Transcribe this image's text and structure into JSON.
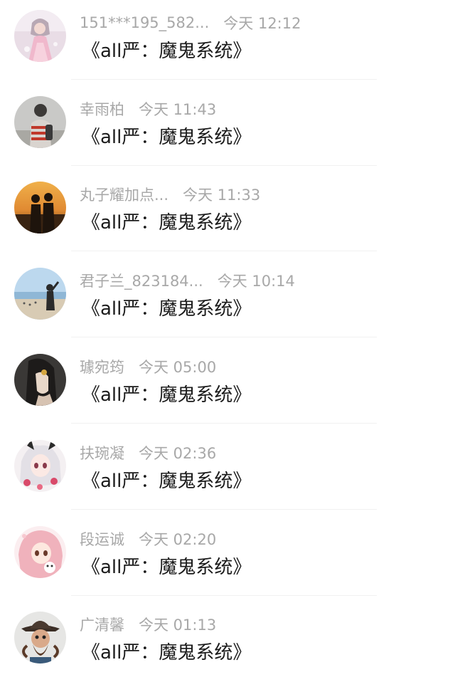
{
  "comments": [
    {
      "avatar": "avatar-girl-pink-dress",
      "username": "151***195_582...",
      "time": "今天 12:12",
      "text": "《all严：魔鬼系统》"
    },
    {
      "avatar": "avatar-person-back-view",
      "username": "幸雨柏",
      "time": "今天 11:43",
      "text": "《all严：魔鬼系统》"
    },
    {
      "avatar": "avatar-couple-sunset",
      "username": "丸子耀加点...",
      "time": "今天 11:33",
      "text": "《all严：魔鬼系统》"
    },
    {
      "avatar": "avatar-beach-person",
      "username": "君子兰_823184...",
      "time": "今天 10:14",
      "text": "《all严：魔鬼系统》"
    },
    {
      "avatar": "avatar-woman-dark",
      "username": "璩宛筠",
      "time": "今天 05:00",
      "text": "《all严：魔鬼系统》"
    },
    {
      "avatar": "avatar-anime-white-hair",
      "username": "扶琬凝",
      "time": "今天 02:36",
      "text": "《all严：魔鬼系统》"
    },
    {
      "avatar": "avatar-anime-pink-hair",
      "username": "段运诚",
      "time": "今天 02:20",
      "text": "《all严：魔鬼系统》"
    },
    {
      "avatar": "avatar-man-hat-beard",
      "username": "广清馨",
      "time": "今天 01:13",
      "text": "《all严：魔鬼系统》"
    }
  ]
}
